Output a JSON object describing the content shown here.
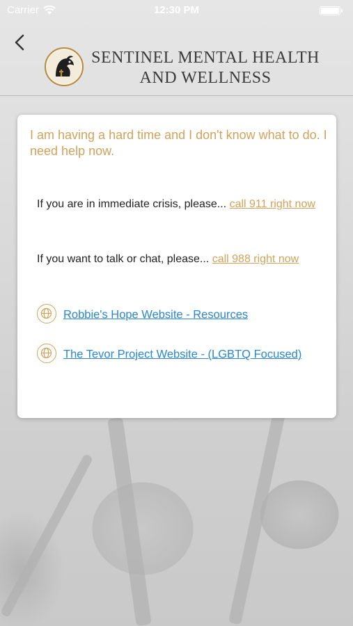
{
  "status_bar": {
    "carrier": "Carrier",
    "time": "12:30 PM"
  },
  "header": {
    "brand_line1": "SENTINEL MENTAL HEALTH",
    "brand_line2": "AND WELLNESS"
  },
  "card": {
    "title": "I am having a hard time and I don't know what to do. I need help now.",
    "crisis_text": "If you are in immediate crisis, please... ",
    "crisis_link": "call 911 right now",
    "talk_text": "If you want to talk or chat, please... ",
    "talk_link": "call 988 right now",
    "resources": [
      {
        "label": "Robbie's Hope Website - Resources",
        "icon": "globe-icon"
      },
      {
        "label": "The Tevor Project Website - (LGBTQ Focused)",
        "icon": "globe-icon"
      }
    ]
  },
  "colors": {
    "accent_gold": "#d2a25a",
    "link_blue": "#2a87d0"
  }
}
